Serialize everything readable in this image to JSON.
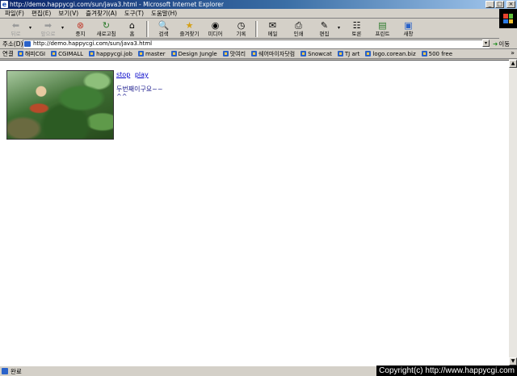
{
  "window": {
    "title": "http://demo.happycgi.com/sun/java3.html - Microsoft Internet Explorer",
    "icon": "ie-icon",
    "controls": [
      "minimize-icon",
      "maximize-icon",
      "close-icon"
    ]
  },
  "menu": [
    "파일(F)",
    "편집(E)",
    "보기(V)",
    "즐겨찾기(A)",
    "도구(T)",
    "도움말(H)"
  ],
  "toolbar": {
    "back": "뒤로",
    "forward": "앞으로",
    "stop": "중지",
    "refresh": "새로고침",
    "home": "홈",
    "search": "검색",
    "favorites": "즐겨찾기",
    "media": "미디어",
    "history": "기록",
    "mail": "메일",
    "print": "인쇄",
    "edit": "편집",
    "discuss": "토론",
    "printer2": "프린트",
    "messenger": "새창"
  },
  "address": {
    "label": "주소(D)",
    "url": "http://demo.happycgi.com/sun/java3.html",
    "go": "이동"
  },
  "links": {
    "label": "연결",
    "items": [
      "해피CGI",
      "CGIMALL",
      "happycgi.job",
      "master",
      "Design Jungle",
      "맛여리",
      "쉐어마이자닷컴",
      "Snowcat",
      "TJ art",
      "logo.corean.biz",
      "500 free"
    ]
  },
  "page": {
    "stop_link": "stop",
    "play_link": "play",
    "message_line1": "두번째이구요~~",
    "message_line2": "^^"
  },
  "status": {
    "text": "완료",
    "copyright": "Copyright(c) http://www.happycgi.com"
  }
}
